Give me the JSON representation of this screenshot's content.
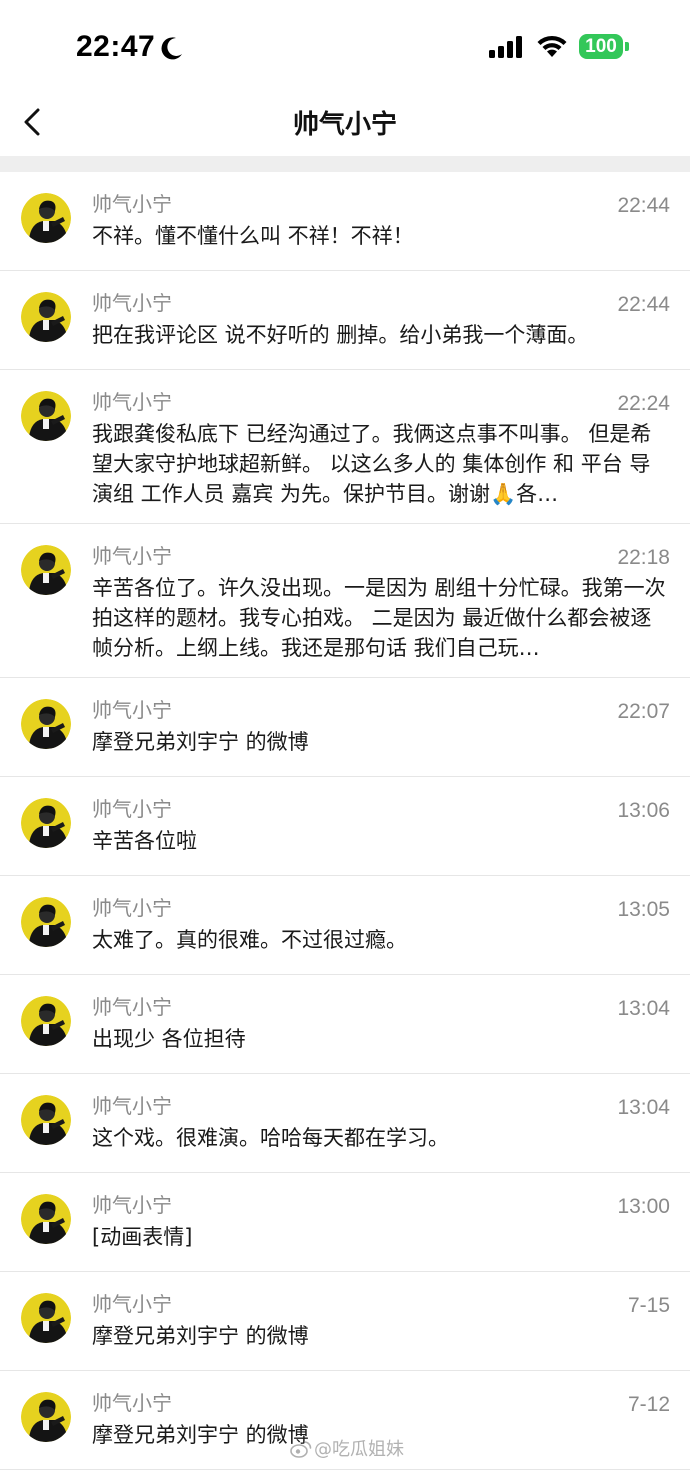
{
  "status": {
    "time": "22:47",
    "battery": "100"
  },
  "header": {
    "title": "帅气小宁"
  },
  "messages": [
    {
      "name": "帅气小宁",
      "time": "22:44",
      "text": "不祥。懂不懂什么叫 不祥！不祥！"
    },
    {
      "name": "帅气小宁",
      "time": "22:44",
      "text": "把在我评论区 说不好听的 删掉。给小弟我一个薄面。"
    },
    {
      "name": "帅气小宁",
      "time": "22:24",
      "text": "我跟龚俊私底下 已经沟通过了。我俩这点事不叫事。 但是希望大家守护地球超新鲜。 以这么多人的 集体创作 和 平台 导演组 工作人员 嘉宾 为先。保护节目。谢谢🙏各…"
    },
    {
      "name": "帅气小宁",
      "time": "22:18",
      "text": "辛苦各位了。许久没出现。一是因为 剧组十分忙碌。我第一次拍这样的题材。我专心拍戏。 二是因为 最近做什么都会被逐帧分析。上纲上线。我还是那句话 我们自己玩…"
    },
    {
      "name": "帅气小宁",
      "time": "22:07",
      "text": "摩登兄弟刘宇宁 的微博"
    },
    {
      "name": "帅气小宁",
      "time": "13:06",
      "text": "辛苦各位啦"
    },
    {
      "name": "帅气小宁",
      "time": "13:05",
      "text": "太难了。真的很难。不过很过瘾。"
    },
    {
      "name": "帅气小宁",
      "time": "13:04",
      "text": "出现少 各位担待"
    },
    {
      "name": "帅气小宁",
      "time": "13:04",
      "text": "这个戏。很难演。哈哈每天都在学习。"
    },
    {
      "name": "帅气小宁",
      "time": "13:00",
      "text": "[动画表情]"
    },
    {
      "name": "帅气小宁",
      "time": "7-15",
      "text": "摩登兄弟刘宇宁 的微博"
    },
    {
      "name": "帅气小宁",
      "time": "7-12",
      "text": "摩登兄弟刘宇宁 的微博"
    }
  ],
  "watermark": "@吃瓜姐妹",
  "colors": {
    "battery": "#33c759",
    "avatar_ring": "#e6d21f",
    "meta_text": "#8a8a8a",
    "divider": "#eeeeee"
  },
  "icons": {
    "back": "chevron-left-icon",
    "moon": "moon-icon",
    "signal": "cellular-signal-icon",
    "wifi": "wifi-icon",
    "battery": "battery-icon",
    "avatar": "user-avatar"
  }
}
